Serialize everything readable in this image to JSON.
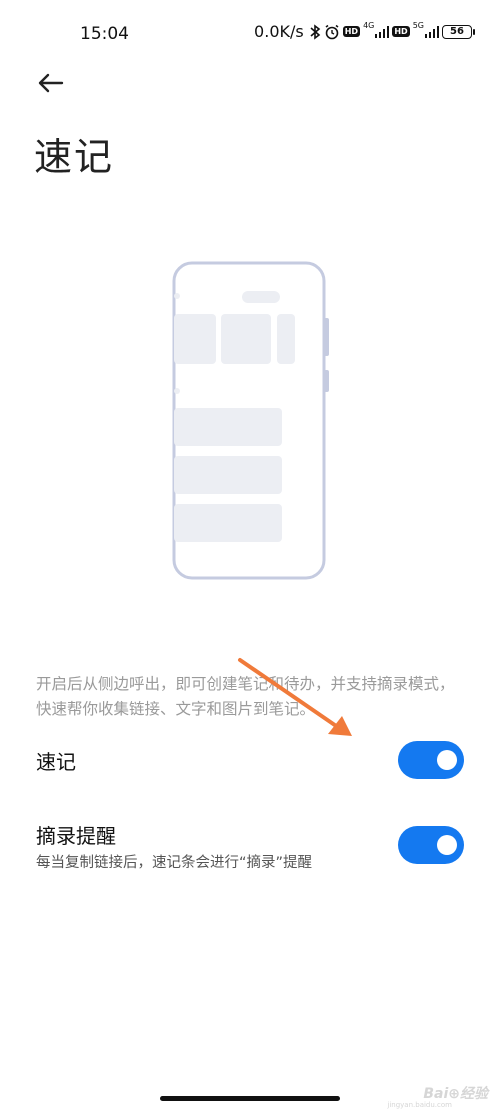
{
  "status_bar": {
    "time": "15:04",
    "speed": "0.0K/s",
    "net1": "4G",
    "net2": "5G",
    "battery": "56",
    "icons": [
      "bluetooth-icon",
      "alarm-icon",
      "hd-icon",
      "signal-icon",
      "hd-icon",
      "signal-icon",
      "battery-icon"
    ]
  },
  "header": {
    "back_icon": "arrow-left-icon",
    "title": "速记"
  },
  "illustration": {
    "icon": "phone-illustration"
  },
  "description": "开启后从侧边呼出，即可创建笔记和待办，并支持摘录模式，快速帮你收集链接、文字和图片到笔记。",
  "settings": [
    {
      "label": "速记",
      "subtitle": "",
      "enabled": true
    },
    {
      "label": "摘录提醒",
      "subtitle": "每当复制链接后，速记条会进行“摘录”提醒",
      "enabled": true
    }
  ],
  "watermark": {
    "text": "Bai⊕经验",
    "sub": "jingyan.baidu.com"
  },
  "colors": {
    "accent": "#1479f0",
    "annotation_arrow": "#f07a3a",
    "illustration_stroke": "#c5cbe0",
    "illustration_fill": "#eceef3"
  }
}
